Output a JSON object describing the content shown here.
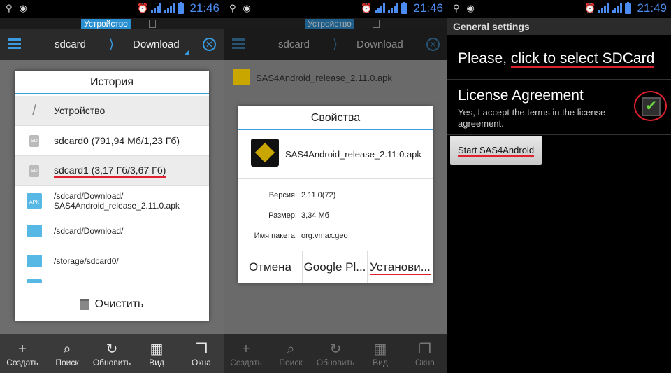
{
  "status_bar": {
    "time_1": "21:46",
    "time_2": "21:46",
    "time_3": "21:49"
  },
  "device_label": "Устройство",
  "action_bar": {
    "crumb_root": "sdcard",
    "crumb_current": "Download"
  },
  "history_dialog": {
    "title": "История",
    "items": [
      {
        "label": "Устройство",
        "icon": "slash-icon"
      },
      {
        "label": "sdcard0 (791,94 Мб/1,23 Гб)",
        "icon": "sd-icon"
      },
      {
        "label": "sdcard1 (3,17 Гб/3,67 Гб)",
        "icon": "sd-icon"
      },
      {
        "label": "/sdcard/Download/\nSAS4Android_release_2.11.0.apk",
        "icon": "apk-icon"
      },
      {
        "label": "/sdcard/Download/",
        "icon": "folder-icon"
      },
      {
        "label": "/storage/sdcard0/",
        "icon": "folder-icon"
      }
    ],
    "clear_label": "Очистить"
  },
  "bottom_bar": {
    "items": [
      {
        "label": "Создать",
        "icon": "plus-icon"
      },
      {
        "label": "Поиск",
        "icon": "search-icon"
      },
      {
        "label": "Обновить",
        "icon": "refresh-icon"
      },
      {
        "label": "Вид",
        "icon": "grid-icon"
      },
      {
        "label": "Окна",
        "icon": "windows-icon"
      }
    ]
  },
  "background_file": {
    "name": "SAS4Android_release_2.11.0.apk"
  },
  "properties_dialog": {
    "title": "Свойства",
    "file_name": "SAS4Android_release_2.11.0.apk",
    "version_label": "Версия:",
    "version_value": "2.11.0(72)",
    "size_label": "Размер:",
    "size_value": "3,34 Мб",
    "package_label": "Имя пакета:",
    "package_value": "org.vmax.geo",
    "buttons": {
      "cancel": "Отмена",
      "google_play": "Google Pl...",
      "install": "Установи..."
    }
  },
  "settings": {
    "header": "General settings",
    "sdcard_prefix": "Please, ",
    "sdcard_link": "click to select SDCard",
    "license_title": "License Agreement",
    "license_sub": "Yes, I accept the terms in the license agreement.",
    "license_checked": true,
    "start_button": "Start SAS4Android"
  },
  "colors": {
    "accent": "#39a0dc",
    "annotation_red": "#e0212f",
    "check_green": "#6cd640"
  }
}
